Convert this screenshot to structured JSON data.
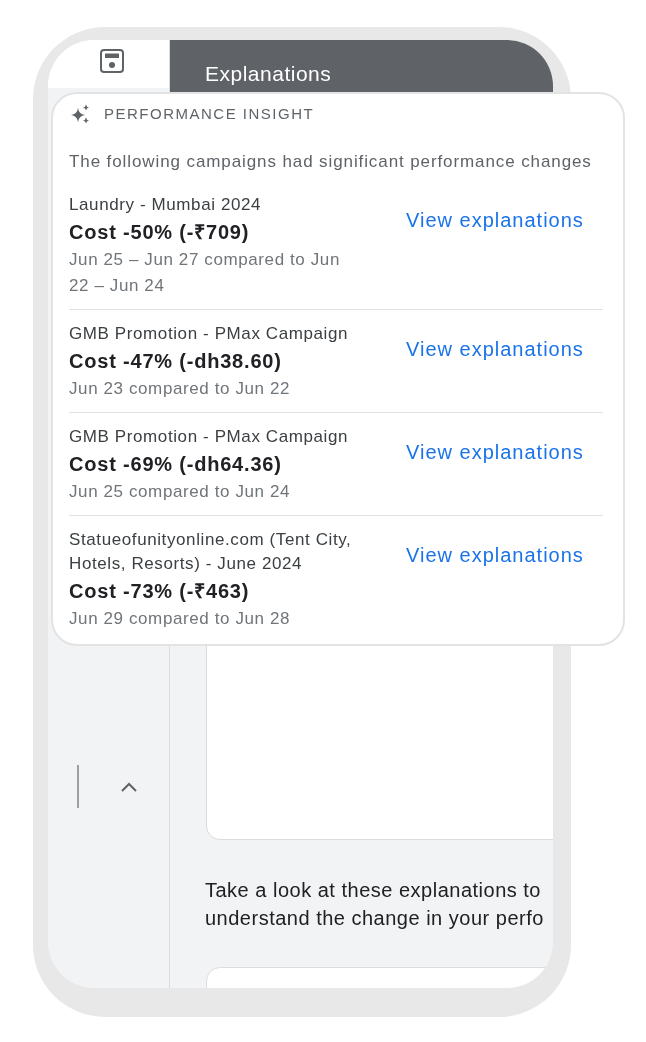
{
  "header": {
    "title": "Explanations"
  },
  "insight_card": {
    "heading": "PERFORMANCE INSIGHT",
    "intro": "The following campaigns had significant performance changes",
    "campaigns": [
      {
        "name": "Laundry - Mumbai 2024",
        "change": "Cost -50% (-₹709)",
        "period": "Jun 25 – Jun 27 compared to Jun 22 – Jun 24",
        "action": "View explanations"
      },
      {
        "name": "GMB Promotion - PMax Campaign",
        "change": "Cost -47% (-dh38.60)",
        "period": "Jun 23 compared to Jun 22",
        "action": "View explanations"
      },
      {
        "name": "GMB Promotion - PMax Campaign",
        "change": "Cost -69% (-dh64.36)",
        "period": "Jun 25 compared to Jun 24",
        "action": "View explanations"
      },
      {
        "name": "Statueofunityonline.com (Tent City, Hotels, Resorts) - June 2024",
        "change": "Cost -73% (-₹463)",
        "period": "Jun 29 compared to Jun 28",
        "action": "View explanations"
      }
    ]
  },
  "hint": {
    "lines": [
      "Take a look at these explanations to",
      "understand the change in your perfo"
    ]
  }
}
